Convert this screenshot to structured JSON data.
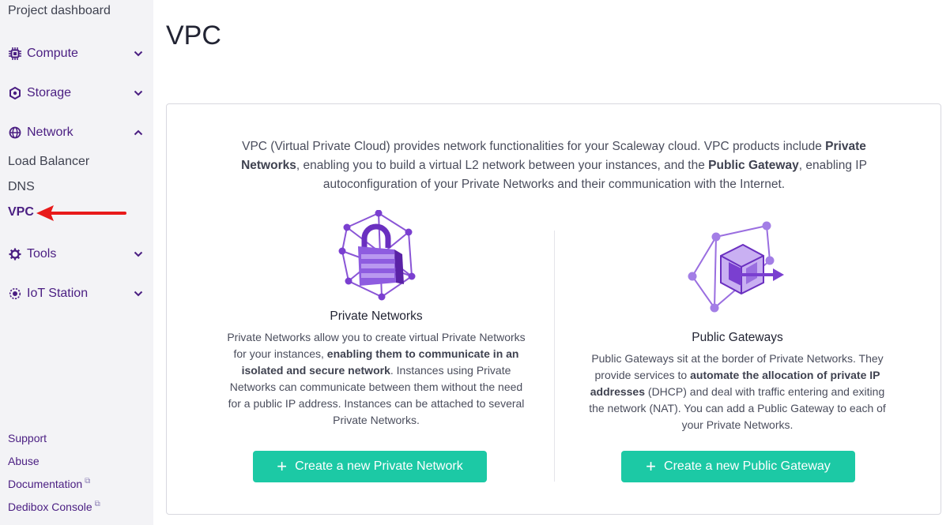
{
  "sidebar": {
    "top_link": "Project dashboard",
    "categories": [
      {
        "label": "Compute",
        "icon": "chip-icon"
      },
      {
        "label": "Storage",
        "icon": "hexagon-icon"
      },
      {
        "label": "Network",
        "icon": "globe-icon"
      },
      {
        "label": "Tools",
        "icon": "gear-icon"
      },
      {
        "label": "IoT Station",
        "icon": "iot-icon"
      }
    ],
    "network_items": [
      "Load Balancer",
      "DNS",
      "VPC"
    ],
    "active_item": "VPC",
    "footer": [
      "Support",
      "Abuse",
      "Documentation",
      "Dedibox Console"
    ]
  },
  "page": {
    "title": "VPC"
  },
  "intro": {
    "p1": "VPC (Virtual Private Cloud) provides network functionalities for your Scaleway cloud. VPC products include ",
    "b1": "Private Networks",
    "p2": ", enabling you to build a virtual L2 network between your instances, and the ",
    "b2": "Public Gateway",
    "p3": ", enabling IP autoconfiguration of your Private Networks and their communication with the Internet."
  },
  "private_networks": {
    "title": "Private Networks",
    "d1": "Private Networks allow you to create virtual Private Networks for your instances, ",
    "b1": "enabling them to communicate in an isolated and secure network",
    "d2": ". Instances using Private Networks can communicate between them without the need for a public IP address. Instances can be attached to several Private Networks.",
    "button": "Create a new Private Network"
  },
  "public_gateways": {
    "title": "Public Gateways",
    "d1": "Public Gateways sit at the border of Private Networks. They provide services to ",
    "b1": "automate the allocation of private IP addresses",
    "d2": " (DHCP) and deal with traffic entering and exiting the network (NAT). You can add a Public Gateway to each of your Private Networks.",
    "button": "Create a new Public Gateway"
  },
  "colors": {
    "accent": "#4a1e82",
    "button": "#1cc9a5",
    "sidebar_bg": "#f3f3f6",
    "annotation_arrow": "#e81a1a"
  }
}
